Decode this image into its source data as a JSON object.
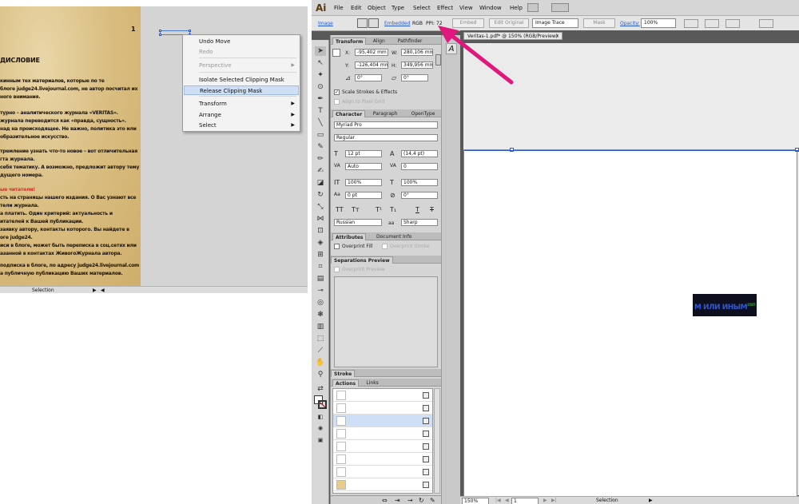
{
  "left_doc": {
    "page_number": "1",
    "lines": [
      {
        "text": "ДИСЛОВИЕ",
        "cls": "hd"
      },
      {
        "text": "кинным тех материалов, которые по те",
        "cls": ""
      },
      {
        "text": "блоге judge24.livejournal.com, не автор посчитал их",
        "cls": ""
      },
      {
        "text": "ного внимания.",
        "cls": ""
      },
      {
        "text": "турно – аналитического журнала «VERITAS».",
        "cls": ""
      },
      {
        "text": "журнала переводится как «правда, сущность».",
        "cls": ""
      },
      {
        "text": "над на происходящее. Не важно, политика это или",
        "cls": ""
      },
      {
        "text": "образительное искусство.",
        "cls": ""
      },
      {
        "text": "тремление узнать что-то новое – вот отличительная",
        "cls": ""
      },
      {
        "text": "гта журнала.",
        "cls": ""
      },
      {
        "text": "себя тематику. А возможно, предложит автору тему",
        "cls": ""
      },
      {
        "text": "дущего номера.",
        "cls": ""
      },
      {
        "text": "ые читатели!",
        "cls": "rd"
      },
      {
        "text": "сть на страницы нашего издания. О Вас узнают все",
        "cls": ""
      },
      {
        "text": "тели журнала.",
        "cls": ""
      },
      {
        "text": "а платить. Один критерий: актуальность и",
        "cls": ""
      },
      {
        "text": "итателей к Вашей публикации.",
        "cls": ""
      },
      {
        "text": "заявку автору, контакты которого. Вы найдете в",
        "cls": ""
      },
      {
        "text": "оге judge24.",
        "cls": ""
      },
      {
        "text": "иси в блоге, может быть переписка в соц.сетях или",
        "cls": ""
      },
      {
        "text": "азанной в контактах ЖивогоЖурнала автора.",
        "cls": ""
      },
      {
        "text": "подписка в блоге, по адресу judge24.livejournal.com",
        "cls": ""
      },
      {
        "text": "а публичную публикацию Ваших материалов.",
        "cls": ""
      }
    ],
    "status_mode": "Selection"
  },
  "context_menu": {
    "items": [
      {
        "label": "Undo Move",
        "state": ""
      },
      {
        "label": "Redo",
        "state": "dis"
      },
      {
        "label": "Perspective",
        "state": "dis",
        "arrow": true
      },
      {
        "label": "Isolate Selected Clipping Mask",
        "state": ""
      },
      {
        "label": "Release Clipping Mask",
        "state": "hl"
      },
      {
        "label": "Transform",
        "state": "",
        "arrow": true
      },
      {
        "label": "Arrange",
        "state": "",
        "arrow": true
      },
      {
        "label": "Select",
        "state": "",
        "arrow": true
      }
    ]
  },
  "menubar": {
    "logo": "Ai",
    "items": [
      "File",
      "Edit",
      "Object",
      "Type",
      "Select",
      "Effect",
      "View",
      "Window",
      "Help"
    ]
  },
  "control": {
    "type_label": "Image",
    "embedded": "Embedded",
    "color_mode": "RGB",
    "ppi": "PPI: 72",
    "embed_btn": "Embed",
    "edit_original": "Edit Original",
    "image_trace": "Image Trace",
    "mask": "Mask",
    "opacity_label": "Opacity:",
    "opacity_value": "100%"
  },
  "transform": {
    "tabs": [
      "Transform",
      "Align",
      "Pathfinder"
    ],
    "x_label": "X:",
    "x": "-95,402 mm",
    "y_label": "Y:",
    "y": "-126,404 mm",
    "w_label": "W:",
    "w": "280,106 mm",
    "h_label": "H:",
    "h": "349,956 mm",
    "angle": "0°",
    "shear": "0°",
    "scale_strokes": "Scale Strokes & Effects",
    "align_pixel": "Align to Pixel Grid"
  },
  "character": {
    "tabs": [
      "Character",
      "Paragraph",
      "OpenType"
    ],
    "font": "Myriad Pro",
    "style": "Regular",
    "size": "12 pt",
    "leading": "(14,4 pt)",
    "kerning": "Auto",
    "tracking": "0",
    "vscale": "100%",
    "hscale": "100%",
    "baseline": "0 pt",
    "rotation": "0°",
    "language": "Russian",
    "aa_label": "aa",
    "antialias": "Sharp"
  },
  "attributes": {
    "tabs": [
      "Attributes",
      "Document Info"
    ],
    "overprint_fill": "Overprint Fill",
    "overprint_stroke": "Overprint Stroke"
  },
  "separations": {
    "tab": "Separations Preview",
    "overprint_preview": "Overprint Preview"
  },
  "stroke": {
    "tab": "Stroke"
  },
  "links": {
    "tabs": [
      "Actions",
      "Links"
    ],
    "rows": 8
  },
  "document": {
    "tab_title": "Veritas-1.pdf* @ 150% (RGB/Preview)",
    "close": "×",
    "logo_text": "М ИЛИ ИНЫМ",
    "logo_sup": "25ХП",
    "zoom": "150%",
    "page": "1",
    "status_mode": "Selection"
  },
  "colors": {
    "accent_arrow": "#e0187c",
    "selection": "#2a5ad0"
  }
}
